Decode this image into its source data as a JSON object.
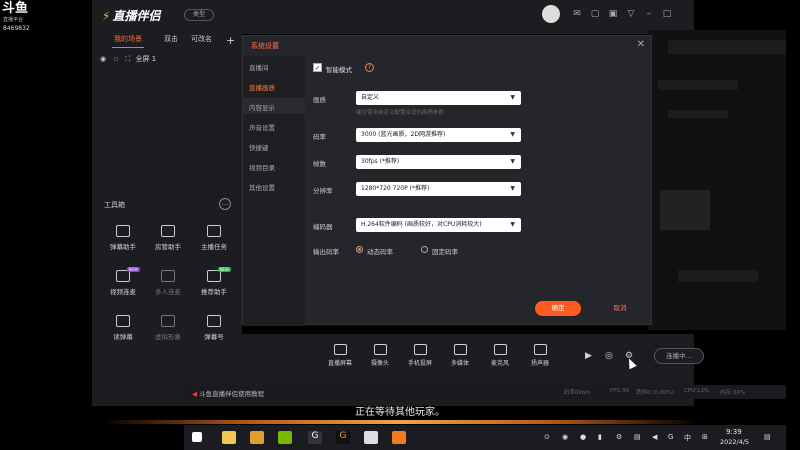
{
  "stream": {
    "logo": "斗鱼",
    "logo_sub": "直播平台",
    "room_id": "8469832"
  },
  "app": {
    "title": "直播伴侣",
    "badge": "类型"
  },
  "scenes": {
    "tabs": [
      "我的场景",
      "双击",
      "可改名"
    ],
    "add": "+",
    "item": "全屏 1"
  },
  "tools": {
    "title": "工具箱",
    "items": [
      {
        "label": "弹幕助手",
        "dim": false
      },
      {
        "label": "房管助手",
        "dim": false
      },
      {
        "label": "主播任务",
        "dim": false
      },
      {
        "label": "视频连麦",
        "dim": false,
        "tag": "NEW"
      },
      {
        "label": "多人连麦",
        "dim": true
      },
      {
        "label": "推荐助手",
        "dim": false,
        "tag": "NEW"
      },
      {
        "label": "读弹幕",
        "dim": false
      },
      {
        "label": "虚拟形象",
        "dim": true
      },
      {
        "label": "弹幕号",
        "dim": false
      }
    ]
  },
  "dialog": {
    "title": "系统设置",
    "close": "✕",
    "nav": [
      "直播间",
      "直播画质",
      "内容显示",
      "声音设置",
      "快捷键",
      "视频目录",
      "其他设置"
    ],
    "active_nav": "直播画质",
    "smart_mode_label": "智能模式",
    "smart_mode_checked": true,
    "rows": [
      {
        "label": "画质",
        "value": "自定义"
      },
      {
        "label": "码率",
        "value": "3000 (蓝光画质，2D网游推荐)"
      },
      {
        "label": "帧数",
        "value": "30fps (*推荐)"
      },
      {
        "label": "分辨率",
        "value": "1280*720 720P (*推荐)"
      },
      {
        "label": "编码器",
        "value": "H.264软件编码 (画质较好，对CPU消耗较大)"
      }
    ],
    "hint": "建议使用自定义配置合适的画质参数",
    "output_bitrate_label": "输出码率",
    "radio": [
      "动态码率",
      "固定码率"
    ],
    "ok": "确定",
    "cancel": "取消"
  },
  "controls": [
    "直播屏幕",
    "摄像头",
    "手机投屏",
    "多媒体",
    "麦克风",
    "扬声器"
  ],
  "live_button": "连播中...",
  "status": {
    "left": "斗鱼直播伴侣使用教程",
    "stats": [
      "码率0kb/s",
      "FPS:30",
      "丢帧0 (0.00%)",
      "CPU:12%",
      "内存:34%"
    ]
  },
  "overlay": "正在等待其他玩家。",
  "taskbar": {
    "time": "9:39",
    "date": "2022/4/5"
  }
}
